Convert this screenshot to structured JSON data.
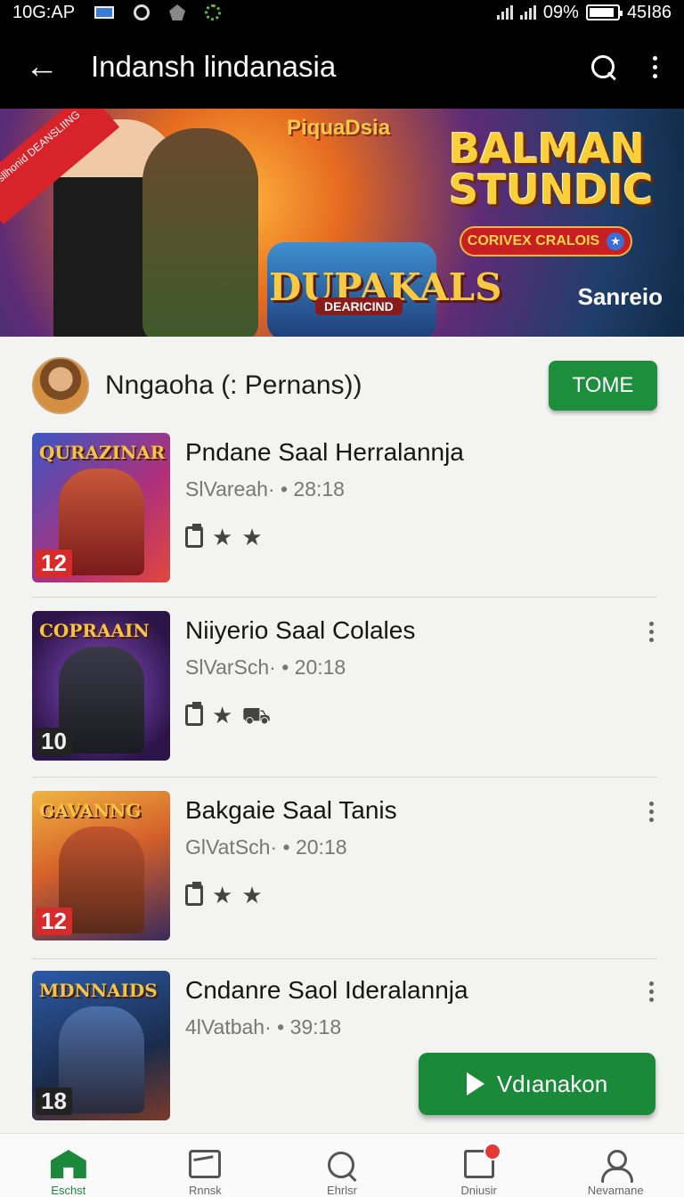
{
  "status_bar": {
    "time": "10G:AP",
    "signal_text": "09%",
    "clock_right": "45I86"
  },
  "app_bar": {
    "back_label": "←",
    "title": "Indansh lindanasia"
  },
  "banner": {
    "ribbon_text": "Isllhonid DEANSLIING",
    "top_logo": "PiquaDsia",
    "headline_line1": "BALMAN",
    "headline_line2": "STUNDIC",
    "pill_text": "CORIVEX CRALOIS",
    "game_name": "DUPAKALS",
    "game_subtitle": "DEARICIND",
    "brand": "Sanreio"
  },
  "profile": {
    "name": "Nngaoha (: Pernans))",
    "button_label": "TOME"
  },
  "games": [
    {
      "title": "Pndane Saal Herralannja",
      "meta": "SlVareah· • 28:18",
      "thumb_title": "QURAZINAR",
      "age": "12",
      "rating_third": "★"
    },
    {
      "title": "Niiyerio Saal Colales",
      "meta": "SlVarSch· • 20:18",
      "thumb_title": "COPRAAIN",
      "age": "10",
      "rating_third": "⛟"
    },
    {
      "title": "Bakgaie Saal Tanis",
      "meta": "GlVatSch· • 20:18",
      "thumb_title": "GAVANNG",
      "age": "12",
      "rating_third": "★"
    },
    {
      "title": "Cndanre Saol Ideralannja",
      "meta": "4lVatbah· • 39:18",
      "thumb_title": "MDNNAIDS",
      "age": "18",
      "rating_third": "★"
    }
  ],
  "play_button": {
    "label": "Vdıanakon"
  },
  "bottom_nav": [
    {
      "label": "Eschst"
    },
    {
      "label": "Rnnsk"
    },
    {
      "label": "Ehrlsr"
    },
    {
      "label": "Dniusir"
    },
    {
      "label": "Nevamane"
    }
  ],
  "colors": {
    "accent": "#1a8a3a",
    "app_bar": "#000000",
    "badge_red": "#d72b2b"
  }
}
